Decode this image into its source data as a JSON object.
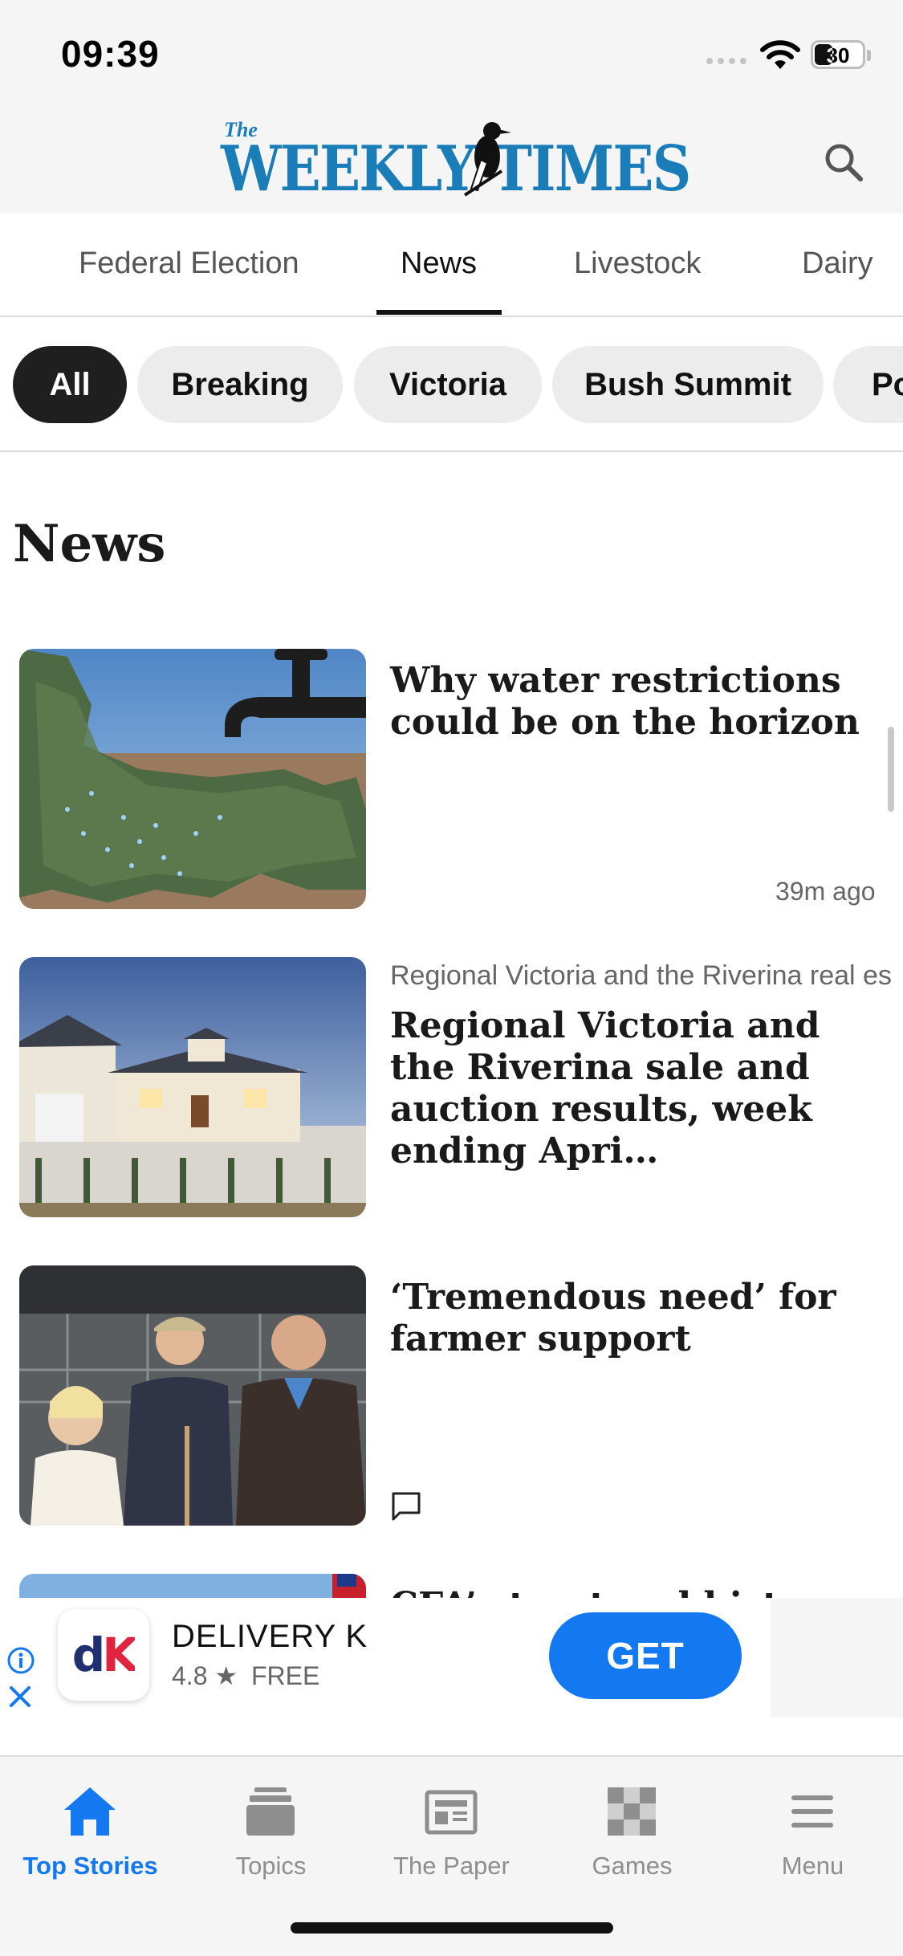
{
  "status_bar": {
    "time": "09:39",
    "battery": "30"
  },
  "header": {
    "logo_prefix": "The",
    "logo_name": "WEEKLY TIMES"
  },
  "section_tabs": [
    {
      "label": "Federal Election"
    },
    {
      "label": "News"
    },
    {
      "label": "Livestock"
    },
    {
      "label": "Dairy"
    }
  ],
  "filter_chips": [
    {
      "label": "All"
    },
    {
      "label": "Breaking"
    },
    {
      "label": "Victoria"
    },
    {
      "label": "Bush Summit"
    },
    {
      "label": "Po"
    }
  ],
  "section_title": "News",
  "articles": [
    {
      "kicker": "",
      "headline": "Why water restrictions could be on the horizon",
      "timestamp": "39m  ago"
    },
    {
      "kicker": "Regional Victoria and the Riverina real es",
      "headline": "Regional Victoria and the Riverina sale and auction results, week ending Apri…",
      "timestamp": ""
    },
    {
      "kicker": "",
      "headline": "‘Tremendous need’ for farmer support",
      "timestamp": ""
    },
    {
      "kicker": "",
      "headline": "CFA’s trust and history",
      "timestamp": ""
    }
  ],
  "ad": {
    "icon_text": "dK",
    "title": "DELIVERY K",
    "rating": "4.8",
    "price": "FREE",
    "cta": "GET"
  },
  "bottom_nav": [
    {
      "label": "Top Stories",
      "icon": "home-icon"
    },
    {
      "label": "Topics",
      "icon": "stack-icon"
    },
    {
      "label": "The Paper",
      "icon": "newspaper-icon"
    },
    {
      "label": "Games",
      "icon": "checkerboard-icon"
    },
    {
      "label": "Menu",
      "icon": "hamburger-icon"
    }
  ],
  "colors": {
    "accent": "#1479f0",
    "brand": "#1b7db8",
    "chip_active": "#1f1f1f"
  }
}
